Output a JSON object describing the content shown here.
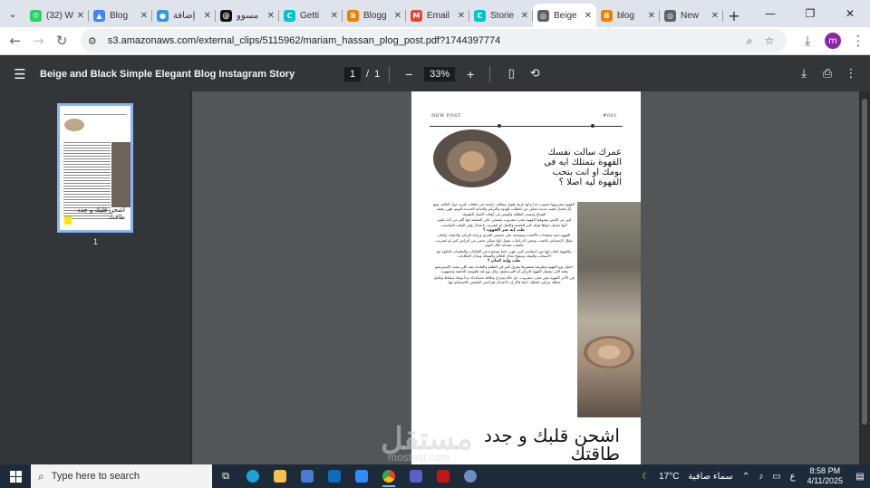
{
  "tabs": [
    {
      "title": "(32) W",
      "color": "#25d366",
      "glyph": "✆"
    },
    {
      "title": "Blog",
      "color": "#4285f4",
      "glyph": "▲"
    },
    {
      "title": "إضافة",
      "color": "#2d9bdb",
      "glyph": "●"
    },
    {
      "title": "مسوو",
      "color": "#111111",
      "glyph": "@"
    },
    {
      "title": "Getti",
      "color": "#00c4cc",
      "glyph": "C"
    },
    {
      "title": "Blogg",
      "color": "#f57d00",
      "glyph": "B"
    },
    {
      "title": "Email",
      "color": "#ea4335",
      "glyph": "M"
    },
    {
      "title": "Storie",
      "color": "#00c4cc",
      "glyph": "C"
    },
    {
      "title": "Beige",
      "color": "#5f6368",
      "glyph": "◎",
      "active": true
    },
    {
      "title": "blog",
      "color": "#f57d00",
      "glyph": "B"
    },
    {
      "title": "New",
      "color": "#5f6368",
      "glyph": "◎"
    }
  ],
  "address": {
    "url": "s3.amazonaws.com/external_clips/5115962/mariam_hassan_plog_post.pdf?1744397774",
    "profile_initial": "m"
  },
  "pdf": {
    "title": "Beige and Black Simple Elegant Blog Instagram Story",
    "current_page": "1",
    "total_pages": "1",
    "page_sep": "/",
    "zoom": "33%"
  },
  "sidebar": {
    "thumb_label": "1",
    "thumb_caption": "اشحن قلبك و جدد طاقتك"
  },
  "page": {
    "tag_left": "NEW POST",
    "tag_right": "#001",
    "headline": "عمرك سالت نفسك القهوة بتمتلك ايه فى يومك او انت بتحب القهوة ليه اصلا ؟",
    "body": [
      "القهوة مشروبها محبوب جدا و لها تاريخ طويل وتقاليد راسخة في ثقافات كثيرة حول العالم، ومع كل فنجان قصة جديدة تحكي عن لحظات الهدوء والتركيز والبداية الجديدة لليوم، فهي رفيقة الصباح ومصدر الطاقة والونس في أوقات العمل الطويلة.",
      "كثير من الناس بيشوفوا القهوة مجرد مشروب بيصحي، لكن الحقيقة إنها أكتر من كده بكتير، لأنها بتحمل جواها فوائد كتير للجسم والعقل لو اتشربت باعتدال وفي الوقت المناسب.",
      "طب إيه سر القهوة ؟",
      "القهوة غنية بمضادات الأكسدة وبتساعد على تحسين المزاج وزيادة التركيز والانتباه، وكمان بتقلل الإحساس بالتعب، وبعض الدراسات بتقول إنها ممكن تحمي من أمراض كتير لو اتشربت بكميات معتدلة خلال اليوم.",
      "والقهوة كمان ليها دور اجتماعي كبير، فهي دايما موجودة في اللقاءات والجلسات الحلوة مع الأصحاب والعيلة، وبتفتح مجال للكلام والضحك وتبادل الحكايات.",
      "طب وإيه كمان ؟",
      "اختيار نوع القهوة وطريقة تحضيرها بيفرق كتير في الطعم والفايدة، فيه اللي بيحب الإسبريسو وفيه اللي بيفضل القهوة التركي أو الفرنساوي، وكل نوع ليه طقوسه الخاصة وجمهوره.",
      "في الآخر القهوة مش مجرد مشروب، دي حالة ومزاج وطاقة بتساعدك تبدأ يومك بنشاط وتكمل شغلك بتركيز، فخليك دايما فاكر إن الاعتدال هو السر الحقيقي للاستمتاع بيها."
    ],
    "footer": "اشحن قلبك و جدد طاقتك"
  },
  "watermark": {
    "main": "مستقل",
    "sub": "mostaql.com"
  },
  "taskbar": {
    "search_placeholder": "Type here to search",
    "weather": "17°C",
    "weather_label": "سماء صافية",
    "lang": "ع",
    "time": "8:58 PM",
    "date": "4/11/2025"
  }
}
